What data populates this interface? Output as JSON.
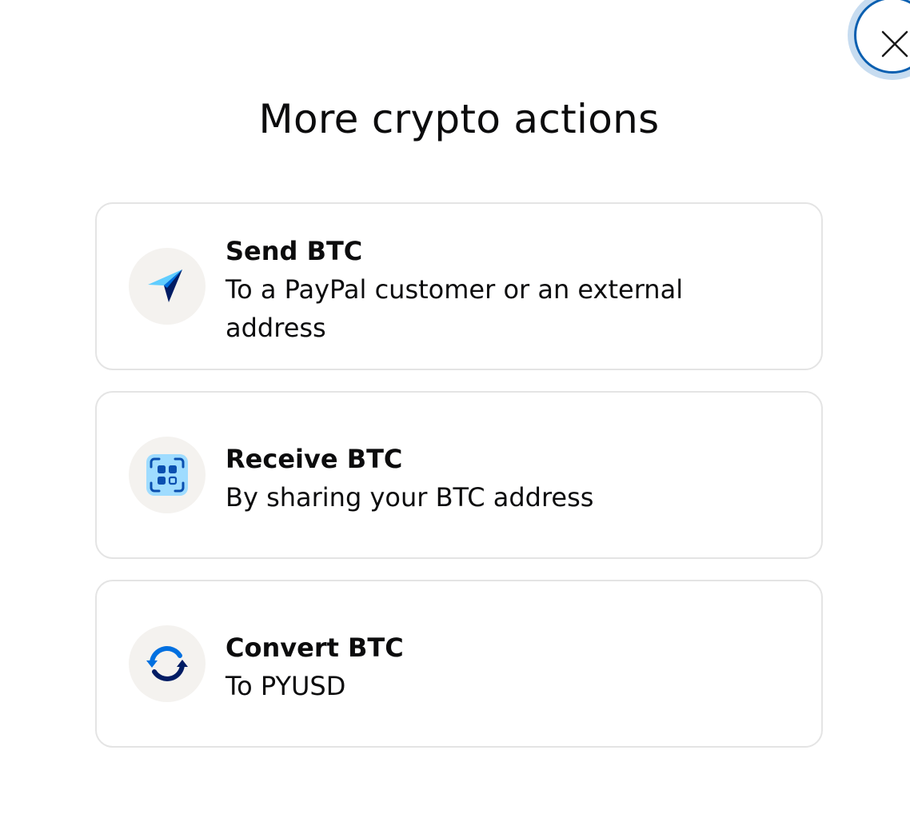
{
  "page": {
    "title": "More crypto actions"
  },
  "close_button": {
    "icon": "close-icon"
  },
  "actions": [
    {
      "icon": "send-arrow-icon",
      "title": "Send BTC",
      "subtitle": "To a PayPal customer or an external address"
    },
    {
      "icon": "qr-code-icon",
      "title": "Receive BTC",
      "subtitle": "By sharing your BTC address"
    },
    {
      "icon": "convert-arrows-icon",
      "title": "Convert BTC",
      "subtitle": "To PYUSD"
    }
  ],
  "colors": {
    "primary_dark": "#001c64",
    "accent_blue": "#0070e0",
    "light_blue": "#60cdff",
    "icon_bg": "#f4f2ef",
    "card_border": "#e4e4e4",
    "close_ring": "#0a5fb0"
  }
}
